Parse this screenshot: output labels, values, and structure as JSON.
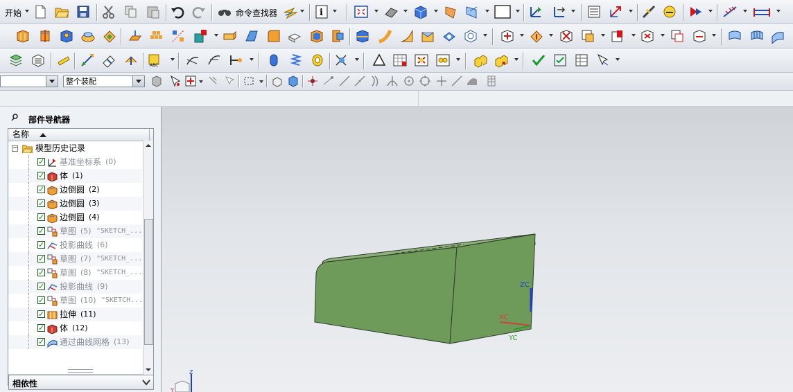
{
  "toolbar": {
    "start_label": "开始",
    "command_finder_label": "命令查找器"
  },
  "selection_bar": {
    "filter_value": "",
    "scope_value": "整个装配"
  },
  "part_navigator": {
    "title": "部件导航器",
    "column_name": "名称",
    "root": "模型历史记录",
    "items": [
      {
        "label": "基准坐标系",
        "num": "(0)",
        "extra": "",
        "checked": true,
        "active": false,
        "icon": "datum-csys-icon"
      },
      {
        "label": "体",
        "num": "(1)",
        "extra": "",
        "checked": true,
        "active": true,
        "icon": "body-icon"
      },
      {
        "label": "边倒圆",
        "num": "(2)",
        "extra": "",
        "checked": true,
        "active": true,
        "icon": "edge-blend-icon"
      },
      {
        "label": "边倒圆",
        "num": "(3)",
        "extra": "",
        "checked": true,
        "active": true,
        "icon": "edge-blend-icon"
      },
      {
        "label": "边倒圆",
        "num": "(4)",
        "extra": "",
        "checked": true,
        "active": true,
        "icon": "edge-blend-icon"
      },
      {
        "label": "草图",
        "num": "(5)",
        "extra": "\"SKETCH_...",
        "checked": true,
        "active": false,
        "icon": "sketch-icon"
      },
      {
        "label": "投影曲线",
        "num": "(6)",
        "extra": "",
        "checked": true,
        "active": false,
        "icon": "projected-curve-icon"
      },
      {
        "label": "草图",
        "num": "(7)",
        "extra": "\"SKETCH_...",
        "checked": true,
        "active": false,
        "icon": "sketch-icon"
      },
      {
        "label": "草图",
        "num": "(8)",
        "extra": "\"SKETCH_...",
        "checked": true,
        "active": false,
        "icon": "sketch-icon"
      },
      {
        "label": "投影曲线",
        "num": "(9)",
        "extra": "",
        "checked": true,
        "active": false,
        "icon": "projected-curve-icon"
      },
      {
        "label": "草图",
        "num": "(10)",
        "extra": "\"SKETCH...",
        "checked": true,
        "active": false,
        "icon": "sketch-icon"
      },
      {
        "label": "拉伸",
        "num": "(11)",
        "extra": "",
        "checked": true,
        "active": true,
        "icon": "extrude-icon"
      },
      {
        "label": "体",
        "num": "(12)",
        "extra": "",
        "checked": true,
        "active": true,
        "icon": "body-icon"
      },
      {
        "label": "通过曲线网格",
        "num": "(13)",
        "extra": "",
        "checked": true,
        "active": false,
        "icon": "through-curve-mesh-icon"
      }
    ],
    "dependencies_label": "相依性"
  },
  "viewport": {
    "csys_labels": {
      "zc": "ZC",
      "xc": "XC",
      "yc": "YC"
    },
    "triad_labels": {
      "z": "Z",
      "y": "Y"
    },
    "model_color": "#6e9a5a"
  }
}
